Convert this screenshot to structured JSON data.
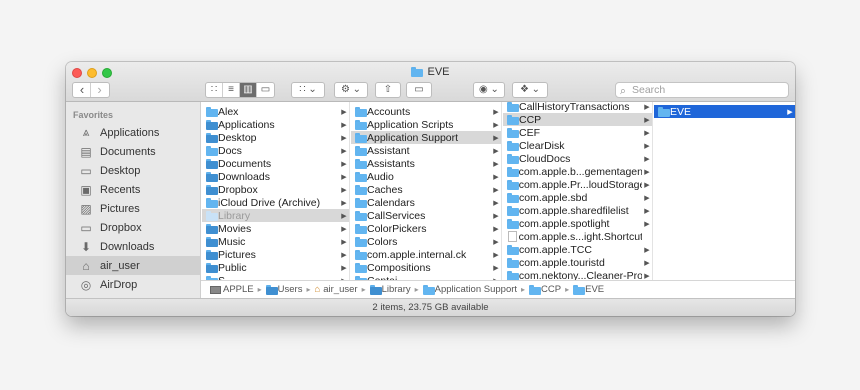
{
  "window": {
    "title": "EVE",
    "status": "2 items, 23.75 GB available"
  },
  "toolbar": {
    "back": "‹",
    "forward": "›",
    "views": [
      "∷",
      "≡",
      "▥",
      "▭"
    ],
    "group": "∷ ⌄",
    "action": "⚙ ⌄",
    "share": "⇧",
    "tag": "▭",
    "eye": "◉ ⌄",
    "dropbox": "❖ ⌄",
    "search_placeholder": "Search"
  },
  "sidebar": {
    "heading": "Favorites",
    "items": [
      {
        "label": "Applications",
        "icon": "applications-icon",
        "glyph": "⩓"
      },
      {
        "label": "Documents",
        "icon": "documents-icon",
        "glyph": "▤"
      },
      {
        "label": "Desktop",
        "icon": "desktop-icon",
        "glyph": "▭"
      },
      {
        "label": "Recents",
        "icon": "recents-icon",
        "glyph": "▣"
      },
      {
        "label": "Pictures",
        "icon": "pictures-icon",
        "glyph": "▨"
      },
      {
        "label": "Dropbox",
        "icon": "dropbox-folder-icon",
        "glyph": "▭"
      },
      {
        "label": "Downloads",
        "icon": "downloads-icon",
        "glyph": "⬇"
      },
      {
        "label": "air_user",
        "icon": "home-icon",
        "glyph": "⌂"
      },
      {
        "label": "AirDrop",
        "icon": "airdrop-icon",
        "glyph": "◎"
      }
    ]
  },
  "columns": [
    {
      "items": [
        {
          "label": "Alex"
        },
        {
          "label": "Applications"
        },
        {
          "label": "Desktop"
        },
        {
          "label": "Docs"
        },
        {
          "label": "Documents"
        },
        {
          "label": "Downloads"
        },
        {
          "label": "Dropbox"
        },
        {
          "label": "iCloud Drive (Archive)"
        },
        {
          "label": "Library"
        },
        {
          "label": "Movies"
        },
        {
          "label": "Music"
        },
        {
          "label": "Pictures"
        },
        {
          "label": "Public"
        },
        {
          "label": "S..."
        }
      ]
    },
    {
      "items": [
        {
          "label": "Accounts"
        },
        {
          "label": "Application Scripts"
        },
        {
          "label": "Application Support"
        },
        {
          "label": "Assistant"
        },
        {
          "label": "Assistants"
        },
        {
          "label": "Audio"
        },
        {
          "label": "Caches"
        },
        {
          "label": "Calendars"
        },
        {
          "label": "CallServices"
        },
        {
          "label": "ColorPickers"
        },
        {
          "label": "Colors"
        },
        {
          "label": "com.apple.internal.ck"
        },
        {
          "label": "Compositions"
        },
        {
          "label": "Contai..."
        }
      ]
    },
    {
      "items": [
        {
          "label": "CallHistoryTransactions"
        },
        {
          "label": "CCP"
        },
        {
          "label": "CEF"
        },
        {
          "label": "ClearDisk"
        },
        {
          "label": "CloudDocs"
        },
        {
          "label": "com.apple.b...gementagent"
        },
        {
          "label": "com.apple.Pr...loudStorage"
        },
        {
          "label": "com.apple.sbd"
        },
        {
          "label": "com.apple.sharedfilelist"
        },
        {
          "label": "com.apple.spotlight"
        },
        {
          "label": "com.apple.s...ight.Shortcuts"
        },
        {
          "label": "com.apple.TCC"
        },
        {
          "label": "com.apple.touristd"
        },
        {
          "label": "com.nektony...Cleaner-Pro"
        }
      ]
    },
    {
      "items": [
        {
          "label": "EVE"
        }
      ]
    }
  ],
  "pathbar": {
    "crumbs": [
      "APPLE",
      "Users",
      "air_user",
      "Library",
      "Application Support",
      "CCP",
      "EVE"
    ],
    "separator": "▸"
  },
  "glyphs": {
    "arrow": "▶",
    "search": "⌕"
  }
}
